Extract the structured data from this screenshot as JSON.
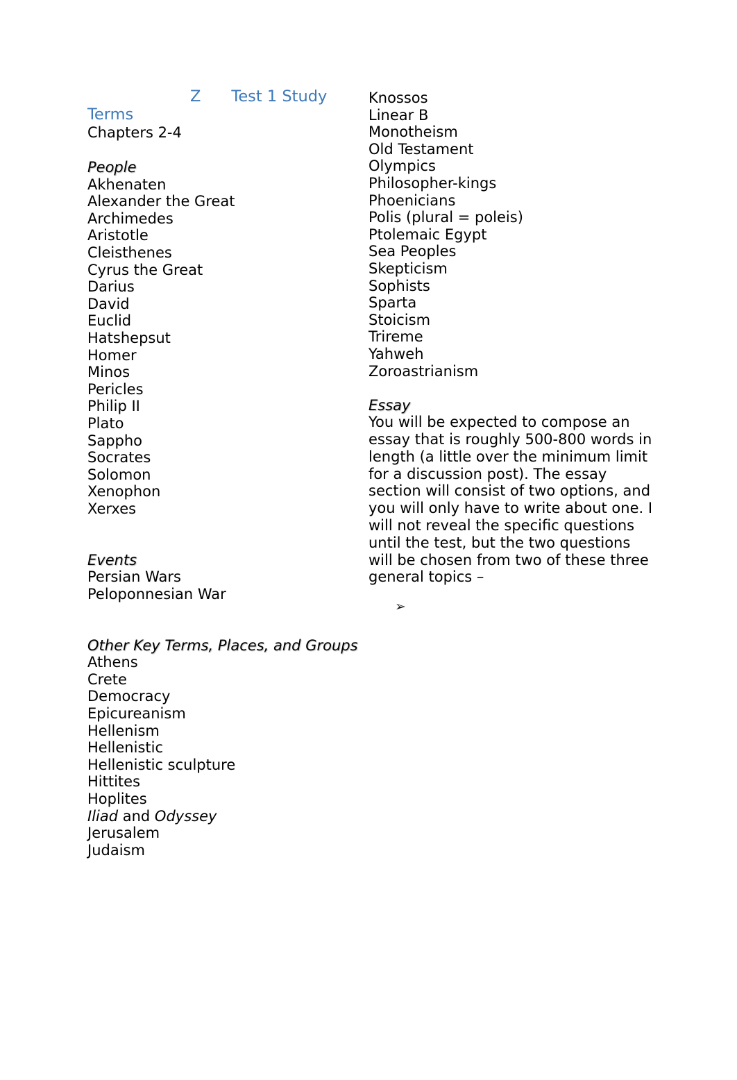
{
  "document": {
    "heading": {
      "z_marker": "Z",
      "title": "Test 1 Study",
      "title_continued": "Terms",
      "chapters": "Chapters 2-4",
      "color": "#3d79b8"
    },
    "left_column": {
      "sections": [
        {
          "subhead": "People",
          "items": [
            "Akhenaten",
            "Alexander the Great",
            "Archimedes",
            "Aristotle",
            "Cleisthenes",
            "Cyrus the Great",
            "Darius",
            "David",
            "Euclid",
            "Hatshepsut",
            "Homer",
            "Minos",
            "Pericles",
            "Philip II",
            "Plato",
            "Sappho",
            "Socrates",
            "Solomon",
            "Xenophon",
            "Xerxes"
          ]
        },
        {
          "subhead": "Events",
          "items": [
            "Persian Wars",
            "Peloponnesian War"
          ]
        },
        {
          "subhead": "Other Key Terms, Places, and Groups",
          "items": [
            "Athens",
            "Crete",
            "Democracy",
            "Epicureanism",
            "Hellenism",
            "Hellenistic",
            "Hellenistic sculpture",
            "Hittites",
            "Hoplites",
            "Iliad and Odyssey",
            "Jerusalem",
            "Judaism"
          ]
        }
      ]
    },
    "right_column": {
      "terms_continued": [
        "Knossos",
        "Linear B",
        "Monotheism",
        "Old Testament",
        "Olympics",
        "Philosopher-kings",
        "Phoenicians",
        "Polis (plural = poleis)",
        "Ptolemaic Egypt",
        "Sea Peoples",
        "Skepticism",
        "Sophists",
        "Sparta",
        "Stoicism",
        "Trireme",
        "Yahweh",
        "Zoroastrianism"
      ],
      "essay": {
        "subhead": "Essay",
        "body": "You will be expected to compose an essay that is roughly 500-800 words in length (a little over the minimum limit for a discussion post).  The essay section will consist of two options, and you will only have to write about one. I will not reveal the specific questions until the test, but the two questions will be chosen from two of these three general topics –",
        "bullet_marker": "➢",
        "bullet_text": ""
      }
    }
  }
}
